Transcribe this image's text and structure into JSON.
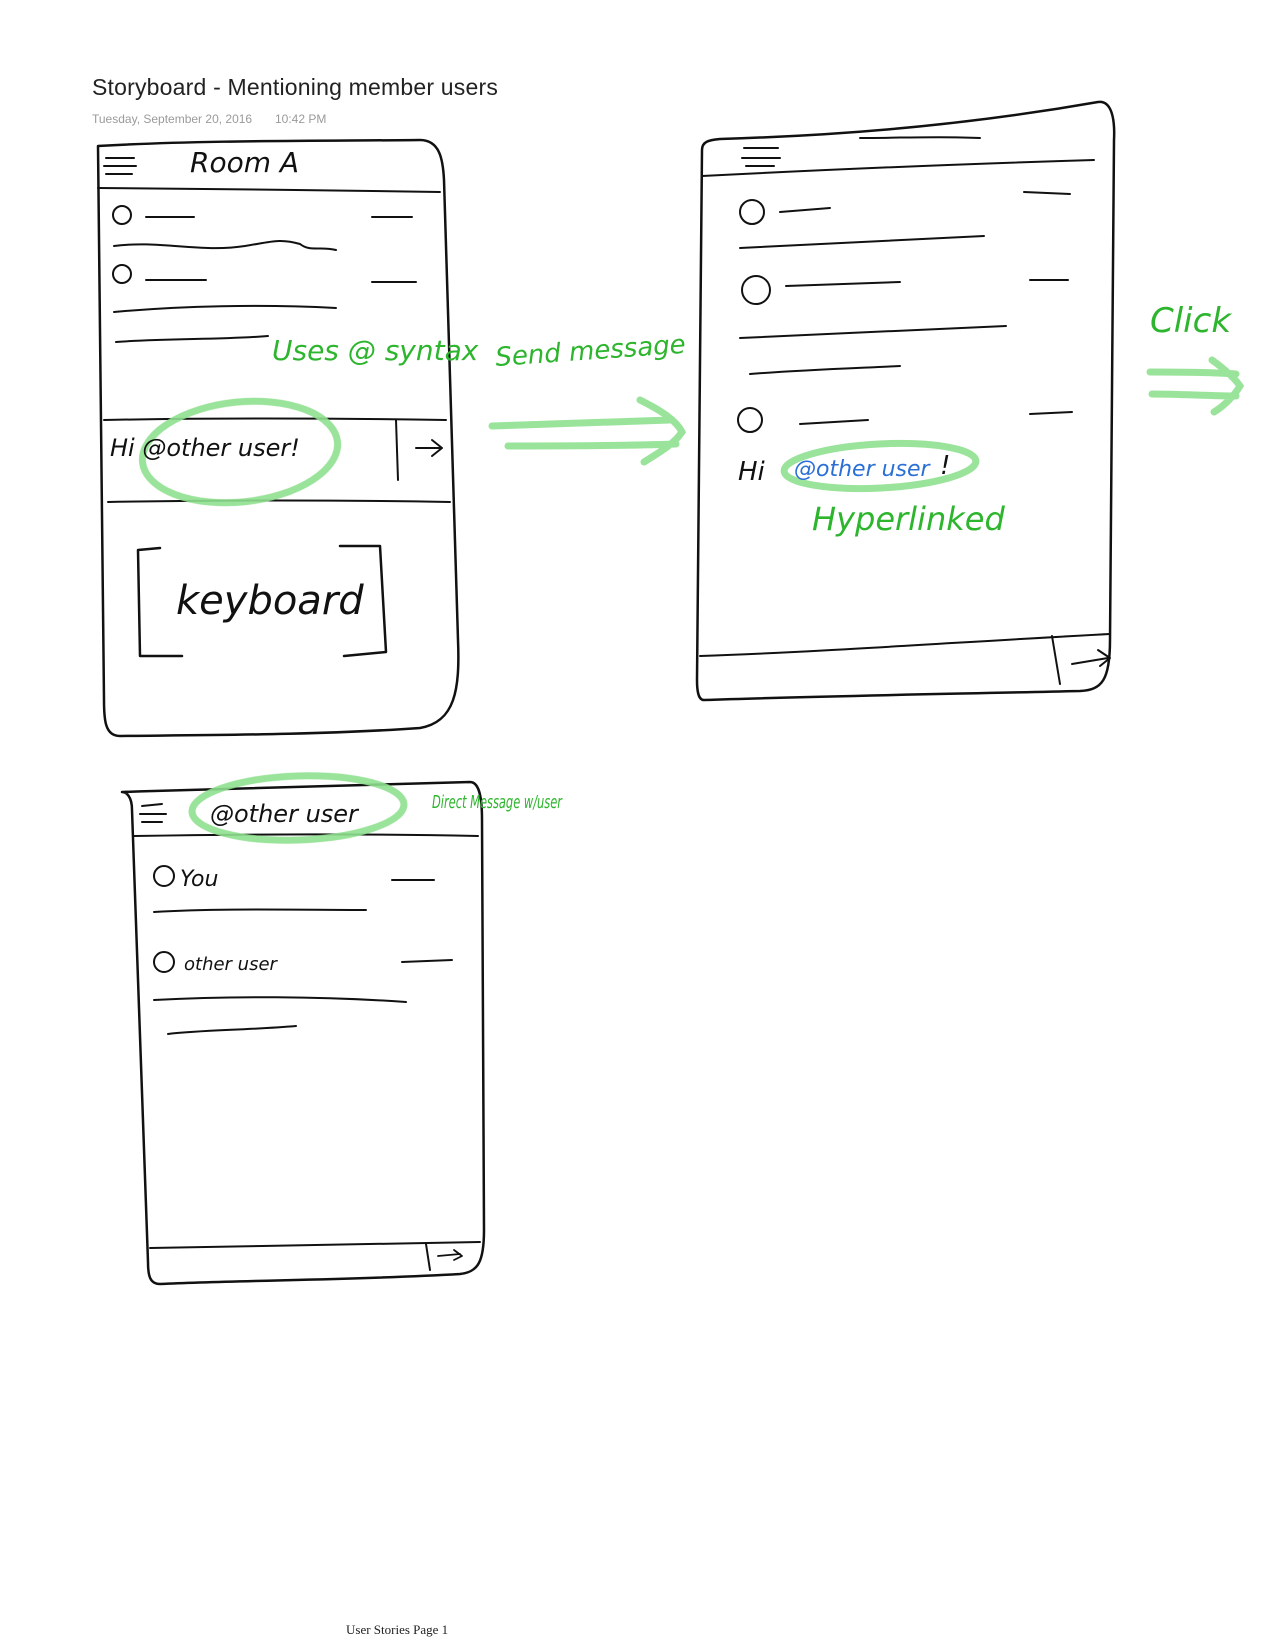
{
  "page": {
    "title": "Storyboard - Mentioning member users",
    "date": "Tuesday, September 20, 2016",
    "time": "10:42 PM",
    "footer": "User Stories Page 1"
  },
  "frame1": {
    "room_title": "Room A",
    "input_text": "Hi @other user!",
    "keyboard_label": "keyboard"
  },
  "frame2": {
    "message_prefix": "Hi",
    "mention": "@other user",
    "message_suffix": "!"
  },
  "frame3": {
    "header_title": "@other user",
    "msg1_author": "You",
    "msg2_author": "other user"
  },
  "annotations": {
    "uses_syntax": "Uses @ syntax",
    "send_message": "Send message",
    "hyperlinked": "Hyperlinked",
    "click": "Click",
    "direct_message": "Direct Message w/user"
  },
  "colors": {
    "ink": "#111111",
    "annotation_green": "#2db52d",
    "highlight_green": "#8fe08f",
    "link_blue": "#2a6fd6"
  }
}
